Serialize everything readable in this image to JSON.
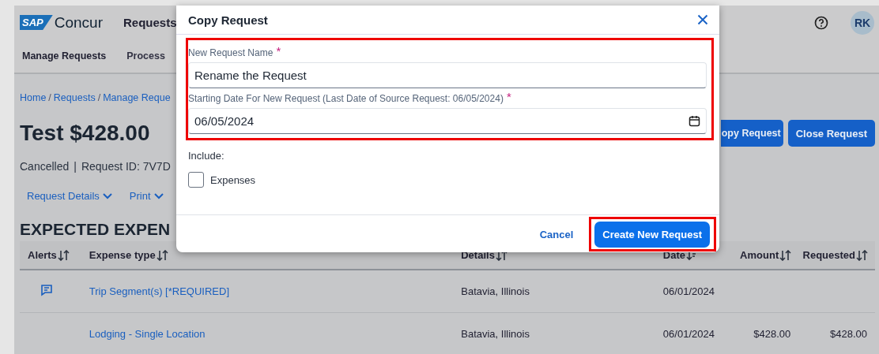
{
  "app": {
    "logo_badge": "SAP",
    "logo_text": "Concur",
    "nav": [
      {
        "label": "Requests",
        "selected": true
      }
    ],
    "subnav": [
      {
        "label": "Manage Requests",
        "selected": true
      },
      {
        "label": "Process",
        "selected": false
      }
    ],
    "avatar": "RK"
  },
  "breadcrumb": {
    "separator": "/",
    "items": [
      "Home",
      "Requests",
      "Manage Reque"
    ]
  },
  "request": {
    "title": "Test $428.00",
    "status": "Cancelled",
    "separator": "|",
    "id_text": "Request ID: 7V7D",
    "header_buttons": [
      "opy Request",
      "Close Request"
    ]
  },
  "actions": [
    "Request Details",
    "Print"
  ],
  "section_title": "EXPECTED EXPEN",
  "table": {
    "columns": [
      {
        "label": "Alerts",
        "sorted": false
      },
      {
        "label": "Expense type",
        "sorted": false
      },
      {
        "label": "Details",
        "sorted": false
      },
      {
        "label": "Date",
        "sorted": true
      },
      {
        "label": "Amount",
        "sorted": false
      },
      {
        "label": "Requested",
        "sorted": false
      }
    ],
    "rows": [
      {
        "alert": true,
        "expense_type": "Trip Segment(s) [*REQUIRED]",
        "details": "Batavia, Illinois",
        "date": "06/01/2024"
      },
      {
        "alert": false,
        "expense_type": "Lodging - Single Location",
        "details": "Batavia, Illinois",
        "date": "06/01/2024",
        "amount": "$428.00",
        "requested": "$428.00"
      }
    ]
  },
  "dialog": {
    "title": "Copy Request",
    "fields_highlighted": true,
    "fields": [
      {
        "kind": "text",
        "label": "New Request Name",
        "required_mark": "*",
        "value": "Rename the Request"
      },
      {
        "kind": "date",
        "label": "Starting Date For New Request (Last Date of Source Request: 06/05/2024)",
        "required_mark": "*",
        "value": "06/05/2024"
      }
    ],
    "include_label": "Include:",
    "options": [
      {
        "label": "Expenses",
        "checked": false
      }
    ],
    "buttons": [
      {
        "kind": "link",
        "label": "Cancel",
        "highlighted": false
      },
      {
        "kind": "primary",
        "label": "Create New Request",
        "highlighted": true
      }
    ]
  }
}
